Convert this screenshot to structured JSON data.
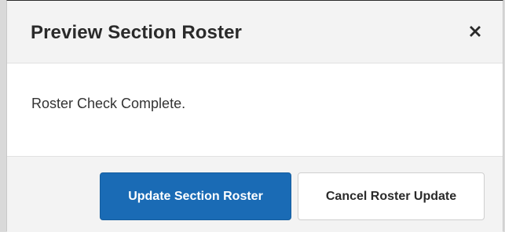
{
  "dialog": {
    "title": "Preview Section Roster",
    "close_icon": "close-icon",
    "message": "Roster Check Complete.",
    "buttons": {
      "primary_label": "Update Section Roster",
      "secondary_label": "Cancel Roster Update"
    }
  },
  "colors": {
    "primary_button": "#1a6bb5",
    "header_background": "#f3f3f3",
    "title_text": "#2a2a2a"
  }
}
